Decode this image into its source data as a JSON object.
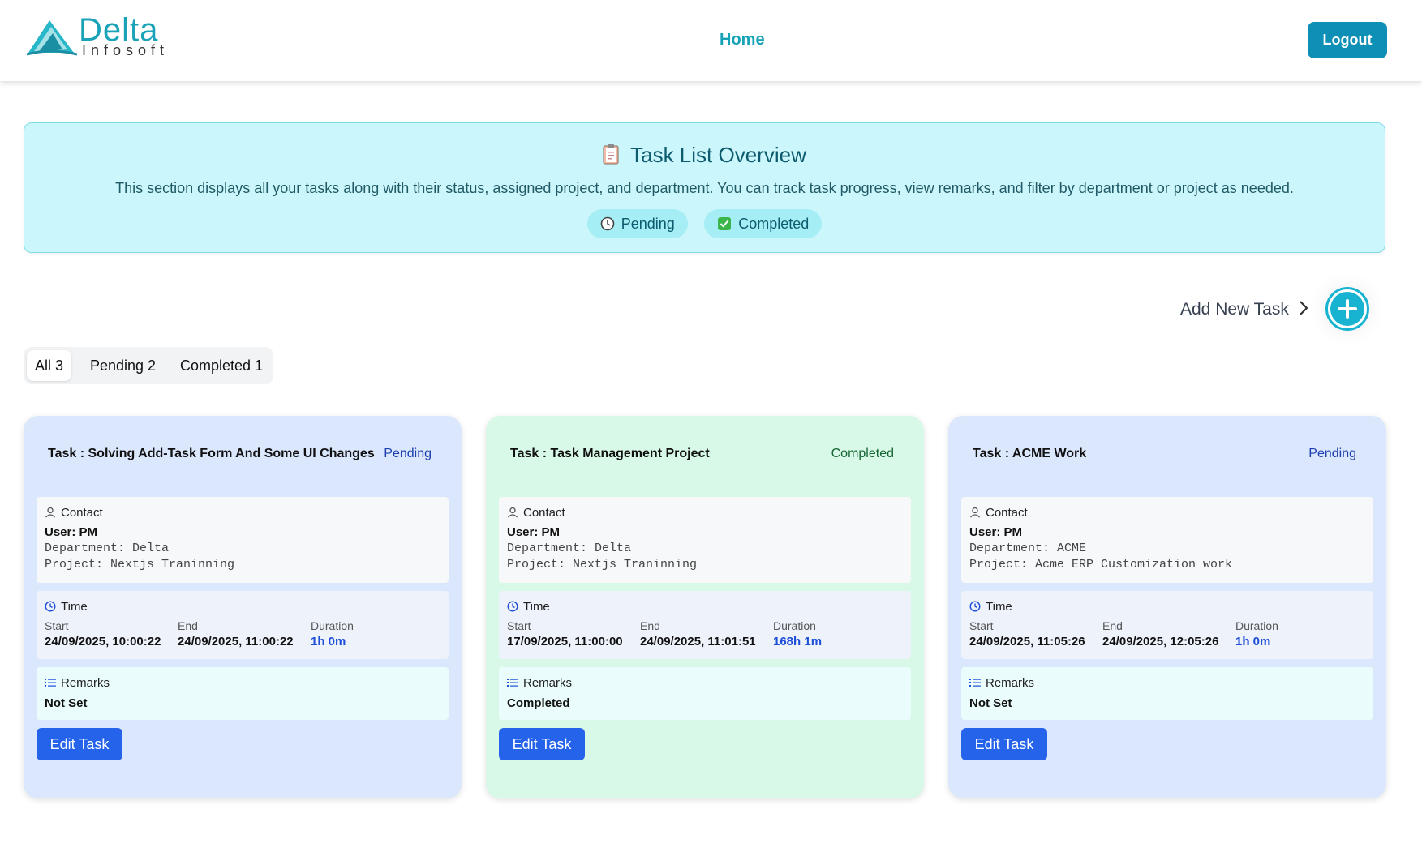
{
  "header": {
    "logo_main": "Delta",
    "logo_sub": "Infosoft",
    "nav_home": "Home",
    "logout_label": "Logout"
  },
  "overview": {
    "title": "Task List Overview",
    "description": "This section displays all your tasks along with their status, assigned project, and department. You can track task progress, view remarks, and filter by department or project as needed.",
    "chip_pending": "Pending",
    "chip_completed": "Completed"
  },
  "add_task": {
    "label": "Add New Task"
  },
  "tabs": [
    {
      "label": "All 3",
      "active": true
    },
    {
      "label": "Pending 2",
      "active": false
    },
    {
      "label": "Completed 1",
      "active": false
    }
  ],
  "cards": [
    {
      "title": "Task : Solving Add-Task Form And Some UI Changes",
      "status": "Pending",
      "contact_heading": "Contact",
      "user": "User: PM",
      "department": "Department: Delta",
      "project": "Project: Nextjs Traninning",
      "time_heading": "Time",
      "start_label": "Start",
      "start": "24/09/2025, 10:00:22",
      "end_label": "End",
      "end": "24/09/2025, 11:00:22",
      "duration_label": "Duration",
      "duration": "1h 0m",
      "remarks_heading": "Remarks",
      "remarks": "Not Set",
      "edit_label": "Edit Task"
    },
    {
      "title": "Task : Task Management Project",
      "status": "Completed",
      "contact_heading": "Contact",
      "user": "User: PM",
      "department": "Department: Delta",
      "project": "Project: Nextjs Traninning",
      "time_heading": "Time",
      "start_label": "Start",
      "start": "17/09/2025, 11:00:00",
      "end_label": "End",
      "end": "24/09/2025, 11:01:51",
      "duration_label": "Duration",
      "duration": "168h 1m",
      "remarks_heading": "Remarks",
      "remarks": "Completed",
      "edit_label": "Edit Task"
    },
    {
      "title": "Task : ACME Work",
      "status": "Pending",
      "contact_heading": "Contact",
      "user": "User: PM",
      "department": "Department: ACME",
      "project": "Project: Acme ERP Customization work",
      "time_heading": "Time",
      "start_label": "Start",
      "start": "24/09/2025, 11:05:26",
      "end_label": "End",
      "end": "24/09/2025, 12:05:26",
      "duration_label": "Duration",
      "duration": "1h 0m",
      "remarks_heading": "Remarks",
      "remarks": "Not Set",
      "edit_label": "Edit Task"
    }
  ],
  "colors": {
    "brand_teal": "#17a2b8",
    "logout_bg": "#0e8fb5",
    "overview_bg": "#cbf6fb",
    "pending_card_bg": "#dbe7fd",
    "completed_card_bg": "#d9f9e8",
    "edit_button_bg": "#2563eb"
  },
  "icons": {
    "overview": "clipboard-icon",
    "pending_chip": "clock-icon",
    "completed_chip": "checkbox-icon",
    "contact": "user-icon",
    "time": "clock-icon",
    "remarks": "list-icon"
  }
}
